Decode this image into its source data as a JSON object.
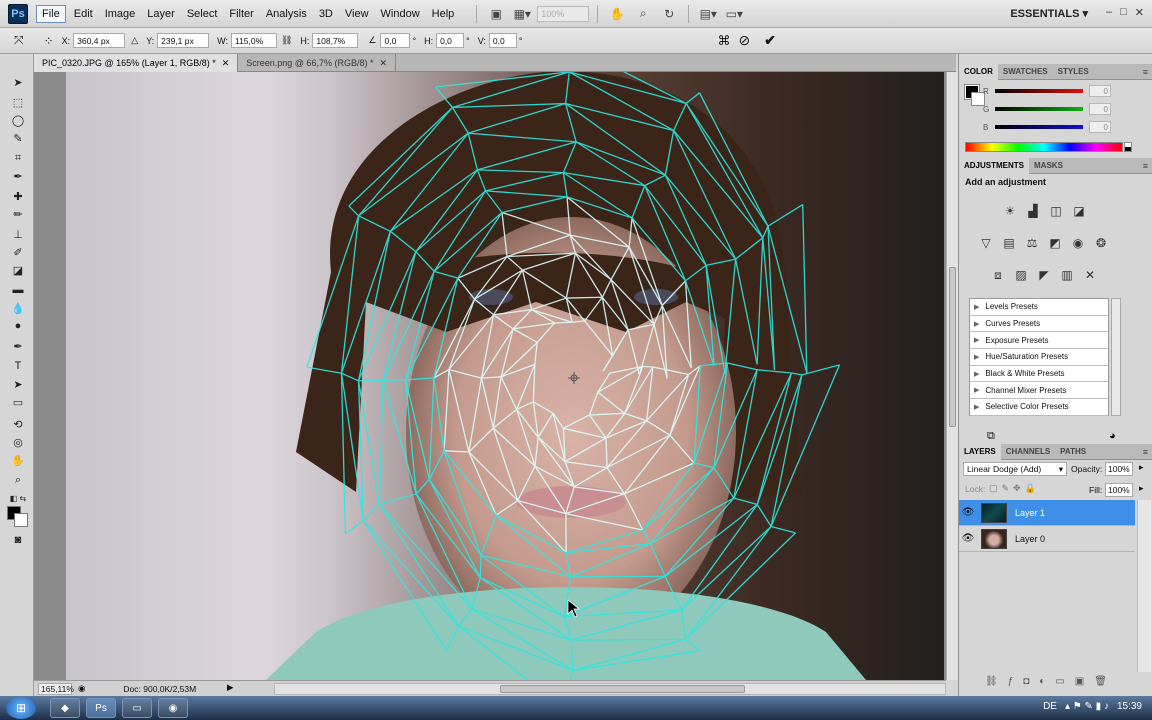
{
  "app": {
    "logo": "Ps"
  },
  "menu": [
    "File",
    "Edit",
    "Image",
    "Layer",
    "Select",
    "Filter",
    "Analysis",
    "3D",
    "View",
    "Window",
    "Help"
  ],
  "zoom_combo": "100%",
  "workspace": "ESSENTIALS",
  "window_controls": [
    "–",
    "□",
    "✕"
  ],
  "options": {
    "x_label": "X:",
    "x_value": "360,4 px",
    "y_label": "Y:",
    "y_value": "239,1 px",
    "w_label": "W:",
    "w_value": "115,0%",
    "h_label": "H:",
    "h_value": "108,7%",
    "angle_value": "0,0",
    "angle_unit": "°",
    "hskew_label": "H:",
    "hskew_value": "0,0",
    "hskew_unit": "°",
    "vskew_label": "V:",
    "vskew_value": "0,0",
    "vskew_unit": "°"
  },
  "tabs": [
    {
      "label": "PIC_0320.JPG @ 165% (Layer 1, RGB/8) *",
      "close": "✕"
    },
    {
      "label": "Screen.png @ 66,7% (RGB/8) *",
      "close": "✕"
    }
  ],
  "status": {
    "zoom": "165,11%",
    "doc": "Doc: 900,0K/2,53M"
  },
  "color_panel": {
    "tabs": [
      "COLOR",
      "SWATCHES",
      "STYLES"
    ],
    "r_label": "R",
    "r_value": "0",
    "g_label": "G",
    "g_value": "0",
    "b_label": "B",
    "b_value": "0",
    "r_color": "#e01010",
    "g_color": "#10b010",
    "b_color": "#1010d0"
  },
  "adjustments": {
    "tabs": [
      "ADJUSTMENTS",
      "MASKS"
    ],
    "title": "Add an adjustment",
    "presets": [
      "Levels Presets",
      "Curves Presets",
      "Exposure Presets",
      "Hue/Saturation Presets",
      "Black & White Presets",
      "Channel Mixer Presets",
      "Selective Color Presets"
    ]
  },
  "layers": {
    "tabs": [
      "LAYERS",
      "CHANNELS",
      "PATHS"
    ],
    "blend_mode": "Linear Dodge (Add)",
    "opacity_label": "Opacity:",
    "opacity_value": "100%",
    "lock_label": "Lock:",
    "fill_label": "Fill:",
    "fill_value": "100%",
    "items": [
      {
        "name": "Layer 1",
        "selected": true
      },
      {
        "name": "Layer 0",
        "selected": false
      }
    ]
  },
  "taskbar": {
    "lang": "DE",
    "time": "15:39"
  },
  "colors": {
    "selection": "#3f8ee8",
    "wireframe": "#2ee8e0"
  }
}
